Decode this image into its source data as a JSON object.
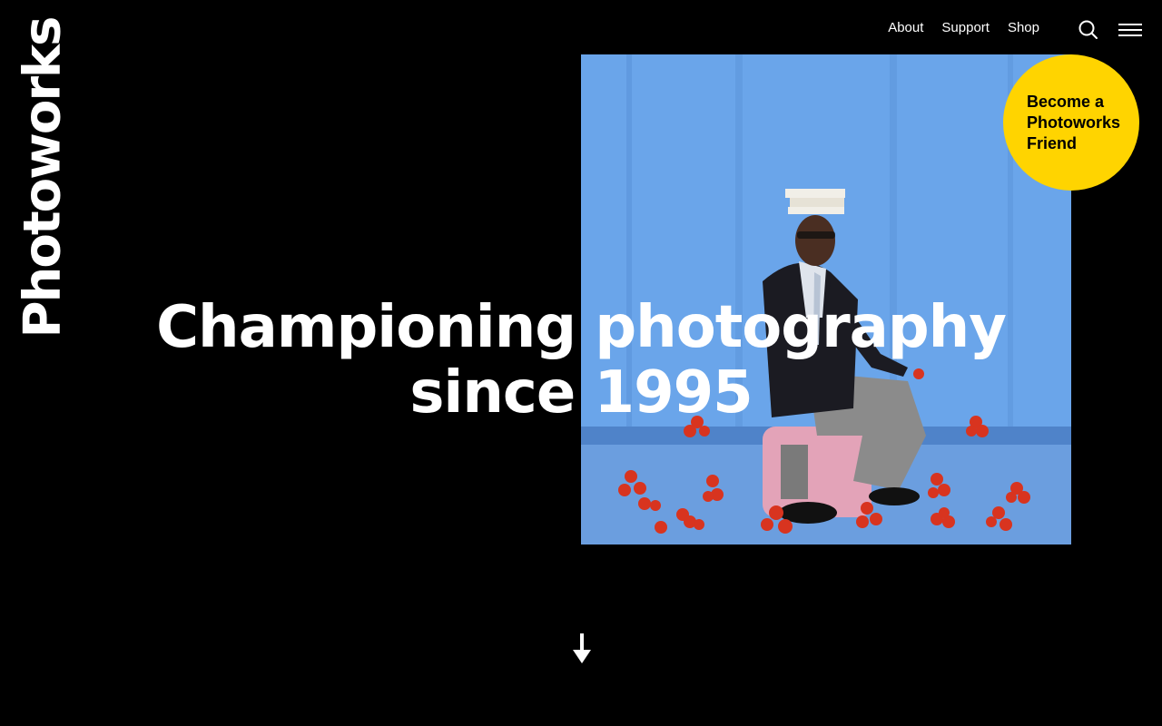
{
  "brand": {
    "logo_text": "Photoworks"
  },
  "nav": {
    "links": [
      "About",
      "Support",
      "Shop"
    ],
    "search_icon": "search-icon",
    "menu_icon": "hamburger-menu-icon"
  },
  "hero": {
    "headline_line1": "Championing photography",
    "headline_line2": "since 1995",
    "image_description_icon": "hero-photograph",
    "badge_text": "Become a Photoworks Friend",
    "badge_color": "#ffd400",
    "scroll_icon": "arrow-down-icon"
  }
}
